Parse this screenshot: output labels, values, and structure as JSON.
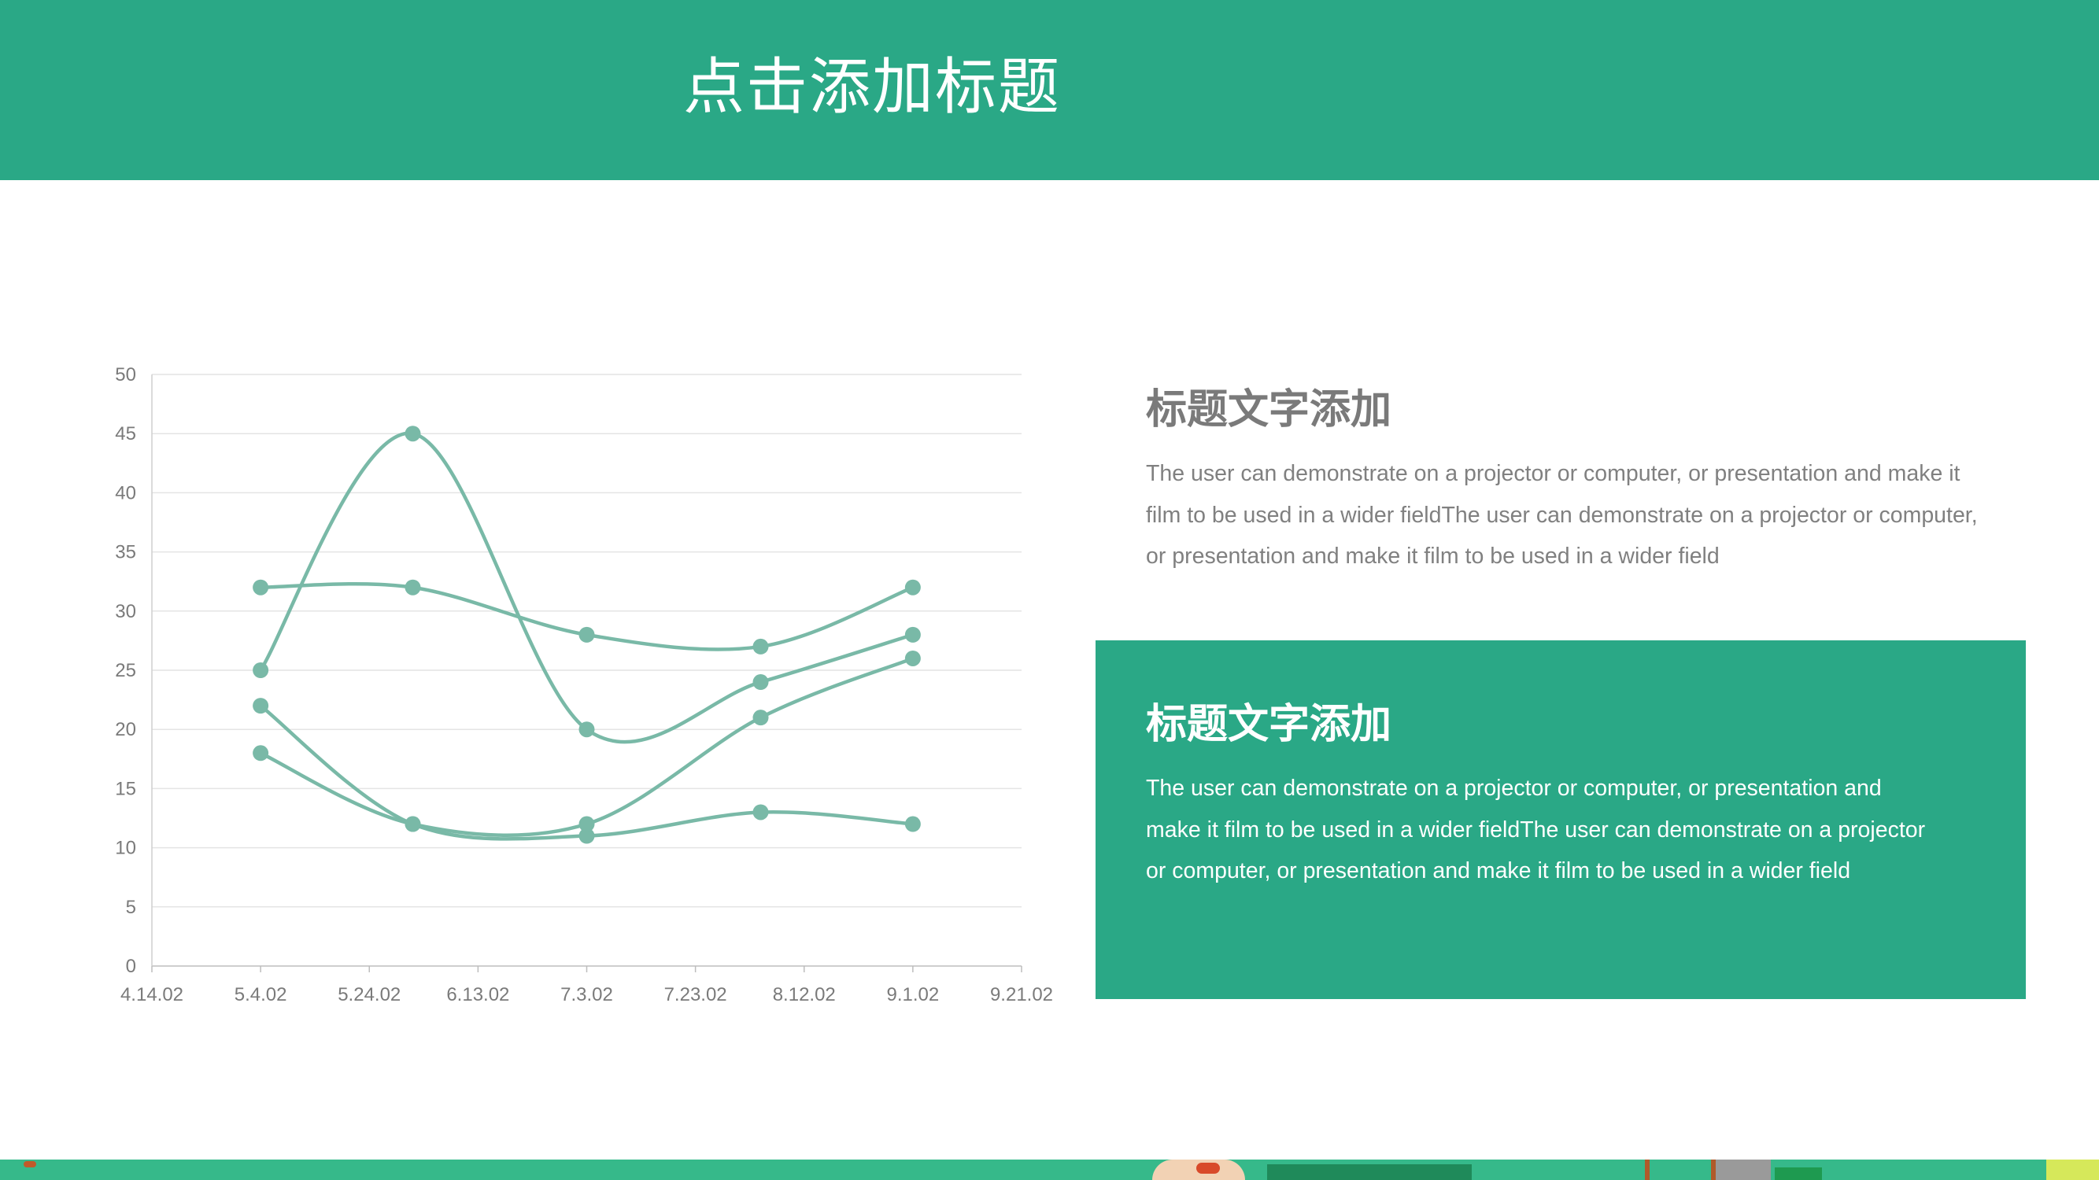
{
  "header": {
    "title": "点击添加标题"
  },
  "colors": {
    "accent": "#2aa886",
    "series_line": "#79b9a7",
    "text_gray": "#7a7a7a"
  },
  "block1": {
    "title": "标题文字添加",
    "body": "The user can demonstrate on a projector or computer, or presentation and make it film to be used in a wider fieldThe user can demonstrate on a projector or computer, or presentation and make it film to be used in a wider field"
  },
  "block2": {
    "title": "标题文字添加",
    "body": "The user can demonstrate on a projector or computer, or presentation and make it film to be used in a wider fieldThe user can demonstrate on a projector or computer, or presentation and make it film to be used in a wider field"
  },
  "chart_data": {
    "type": "line",
    "x_ticks": [
      "4.14.02",
      "5.4.02",
      "5.24.02",
      "6.13.02",
      "7.3.02",
      "7.23.02",
      "8.12.02",
      "9.1.02",
      "9.21.02"
    ],
    "x": [
      "2002-05-04",
      "2002-06-01",
      "2002-07-03",
      "2002-08-04",
      "2002-09-01"
    ],
    "xlim": [
      "2002-04-14",
      "2002-09-21"
    ],
    "ylim": [
      0,
      50
    ],
    "y_ticks": [
      0,
      5,
      10,
      15,
      20,
      25,
      30,
      35,
      40,
      45,
      50
    ],
    "grid": true,
    "smooth": true,
    "series": [
      {
        "values": [
          25,
          45,
          20,
          24,
          28
        ]
      },
      {
        "values": [
          32,
          32,
          28,
          27,
          32
        ]
      },
      {
        "values": [
          22,
          12,
          11,
          13,
          12
        ]
      },
      {
        "values": [
          18,
          12,
          12,
          21,
          26
        ]
      }
    ]
  }
}
